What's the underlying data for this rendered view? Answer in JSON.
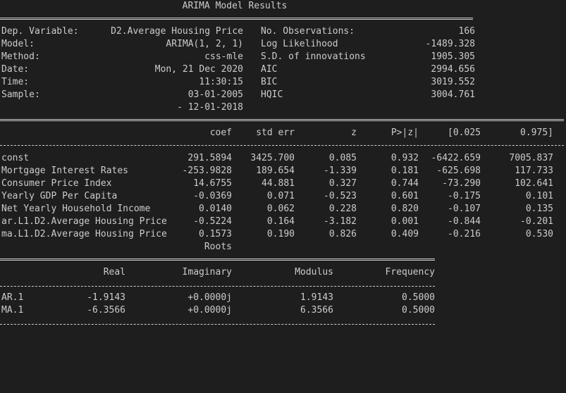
{
  "title": "ARIMA Model Results",
  "header": [
    {
      "label": "Dep. Variable:",
      "value": "D2.Average Housing Price",
      "label2": "No. Observations:",
      "value2": "166"
    },
    {
      "label": "Model:",
      "value": "ARIMA(1, 2, 1)",
      "label2": "Log Likelihood",
      "value2": "-1489.328"
    },
    {
      "label": "Method:",
      "value": "css-mle",
      "label2": "S.D. of innovations",
      "value2": "1905.305"
    },
    {
      "label": "Date:",
      "value": "Mon, 21 Dec 2020",
      "label2": "AIC",
      "value2": "2994.656"
    },
    {
      "label": "Time:",
      "value": "11:30:15",
      "label2": "BIC",
      "value2": "3019.552"
    },
    {
      "label": "Sample:",
      "value": "03-01-2005",
      "label2": "HQIC",
      "value2": "3004.761"
    },
    {
      "label": "",
      "value": "- 12-01-2018",
      "label2": "",
      "value2": ""
    }
  ],
  "coef_headers": [
    "coef",
    "std err",
    "z",
    "P>|z|",
    "[0.025",
    "0.975]"
  ],
  "coef_rows": [
    {
      "name": "const",
      "coef": "291.5894",
      "std_err": "3425.700",
      "z": "0.085",
      "p": "0.932",
      "lo": "-6422.659",
      "hi": "7005.837"
    },
    {
      "name": "Mortgage Interest Rates",
      "coef": "-253.9828",
      "std_err": "189.654",
      "z": "-1.339",
      "p": "0.181",
      "lo": "-625.698",
      "hi": "117.733"
    },
    {
      "name": "Consumer Price Index",
      "coef": "14.6755",
      "std_err": "44.881",
      "z": "0.327",
      "p": "0.744",
      "lo": "-73.290",
      "hi": "102.641"
    },
    {
      "name": "Yearly GDP Per Capita",
      "coef": "-0.0369",
      "std_err": "0.071",
      "z": "-0.523",
      "p": "0.601",
      "lo": "-0.175",
      "hi": "0.101"
    },
    {
      "name": "Net Yearly Household Income",
      "coef": "0.0140",
      "std_err": "0.062",
      "z": "0.228",
      "p": "0.820",
      "lo": "-0.107",
      "hi": "0.135"
    },
    {
      "name": "ar.L1.D2.Average Housing Price",
      "coef": "-0.5224",
      "std_err": "0.164",
      "z": "-3.182",
      "p": "0.001",
      "lo": "-0.844",
      "hi": "-0.201"
    },
    {
      "name": "ma.L1.D2.Average Housing Price",
      "coef": "0.1573",
      "std_err": "0.190",
      "z": "0.826",
      "p": "0.409",
      "lo": "-0.216",
      "hi": "0.530"
    }
  ],
  "roots_title": "Roots",
  "roots_headers": [
    "Real",
    "Imaginary",
    "Modulus",
    "Frequency"
  ],
  "roots_rows": [
    {
      "name": "AR.1",
      "real": "-1.9143",
      "imag": "+0.0000j",
      "mod": "1.9143",
      "freq": "0.5000"
    },
    {
      "name": "MA.1",
      "real": "-6.3566",
      "imag": "+0.0000j",
      "mod": "6.3566",
      "freq": "0.5000"
    }
  ]
}
